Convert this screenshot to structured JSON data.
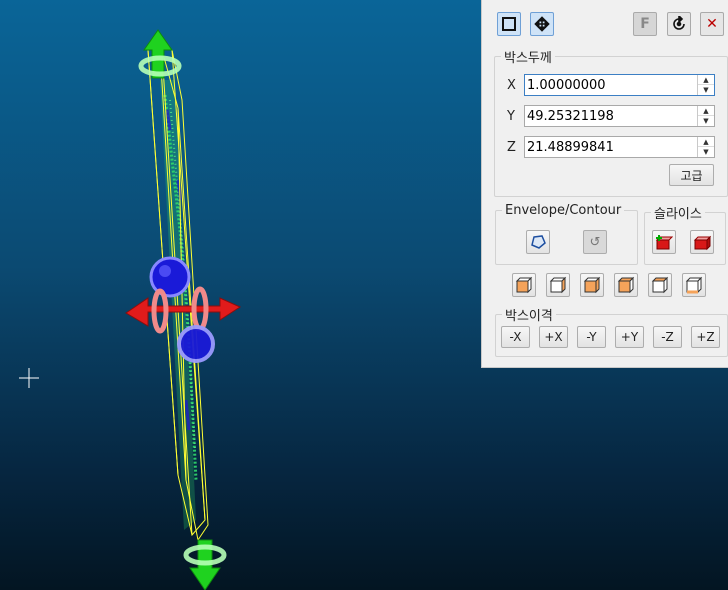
{
  "toolbar": {
    "select_icon": "select-box-icon",
    "move_icon": "move-arrows-icon",
    "font_icon": "font-icon",
    "reset_icon": "reset-icon",
    "close_icon": "close-icon"
  },
  "thickness": {
    "legend": "박스두께",
    "x_label": "X",
    "x_value": "1.00000000",
    "y_label": "Y",
    "y_value": "49.25321198",
    "z_label": "Z",
    "z_value": "21.48899841",
    "advanced_label": "고급"
  },
  "envelope": {
    "legend": "Envelope/Contour",
    "contour_icon": "contour-icon",
    "undo_icon": "undo-icon"
  },
  "slice": {
    "legend": "슬라이스",
    "add_icon": "slice-add-icon",
    "remove_icon": "slice-remove-icon"
  },
  "views": [
    "view-front-icon",
    "view-back-icon",
    "view-left-icon",
    "view-right-icon",
    "view-top-icon",
    "view-bottom-icon"
  ],
  "move": {
    "legend": "박스이격",
    "buttons": [
      "-X",
      "+X",
      "-Y",
      "+Y",
      "-Z",
      "+Z"
    ]
  },
  "colors": {
    "viewport_top": "#0a6598",
    "viewport_bottom": "#031522",
    "box_outline": "#ffff33",
    "point_cloud": "#2fd96a",
    "gizmo_green": "#1fd21f",
    "gizmo_red": "#e11b1b",
    "gizmo_blue": "#1a1ad8"
  }
}
